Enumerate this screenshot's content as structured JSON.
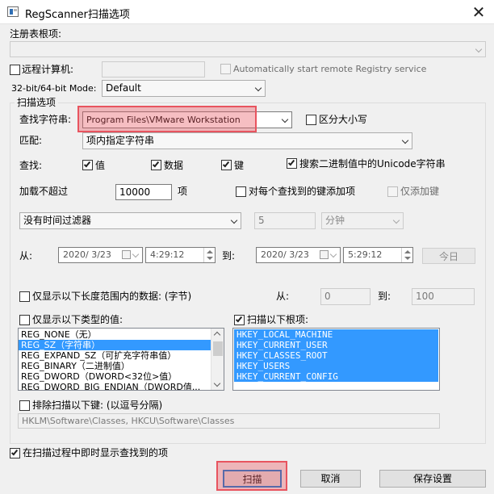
{
  "window": {
    "title": "RegScanner扫描选项",
    "close_glyph": "✕"
  },
  "registry_key": {
    "label": "注册表根项:",
    "value": ""
  },
  "remote": {
    "label": "远程计算机:",
    "value": "",
    "auto_start_label": "Automatically start remote Registry service"
  },
  "mode": {
    "label": "32-bit/64-bit Mode:",
    "value": "Default"
  },
  "scan_options": {
    "group_label": "扫描选项",
    "find_string_label": "查找字符串:",
    "find_string_value": "Program Files\\VMware Workstation",
    "case_sensitive_label": "区分大小写",
    "match_label": "匹配:",
    "match_value": "项内指定字符串",
    "find_label": "查找:",
    "find_values_label": "值",
    "find_data_label": "数据",
    "find_keys_label": "键",
    "find_binary_label": "搜索二进制值中的Unicode字符串",
    "load_limit_label": "加载不超过",
    "load_limit_value": "10000",
    "load_limit_unit": "项",
    "add_key_label": "对每个查找到的键添加项",
    "add_key_only_label": "仅添加键",
    "time_filter_value": "没有时间过滤器",
    "time_amount": "5",
    "time_unit": "分钟",
    "from_label": "从:",
    "from_date": "2020/  3/23",
    "from_time": "4:29:12",
    "to_label": "到:",
    "to_date": "2020/  3/23",
    "to_time": "5:29:12",
    "today_label": "今日"
  },
  "length_filter": {
    "label": "仅显示以下长度范围内的数据: (字节)",
    "from_label": "从:",
    "from_value": "0",
    "to_label": "到:",
    "to_value": "100"
  },
  "value_types": {
    "label": "仅显示以下类型的值:",
    "items": [
      "REG_NONE（无）",
      "REG_SZ（字符串）",
      "REG_EXPAND_SZ（可扩充字符串值）",
      "REG_BINARY（二进制值）",
      "REG_DWORD（DWORD<32位>值）",
      "REG_DWORD_BIG_ENDIAN（DWORD值..."
    ]
  },
  "root_keys": {
    "label": "扫描以下根项:",
    "items": [
      "HKEY_LOCAL_MACHINE",
      "HKEY_CURRENT_USER",
      "HKEY_CLASSES_ROOT",
      "HKEY_USERS",
      "HKEY_CURRENT_CONFIG"
    ]
  },
  "exclude": {
    "label": "排除扫描以下键: (以逗号分隔)",
    "value": "HKLM\\Software\\Classes, HKCU\\Software\\Classes"
  },
  "realtime": {
    "label": "在扫描过程中即时显示查找到的项"
  },
  "buttons": {
    "scan": "扫描",
    "cancel": "取消",
    "save": "保存设置"
  },
  "colors": {
    "selection": "#3399ff",
    "highlight": "#e8545f",
    "background": "#f0f0f0"
  }
}
